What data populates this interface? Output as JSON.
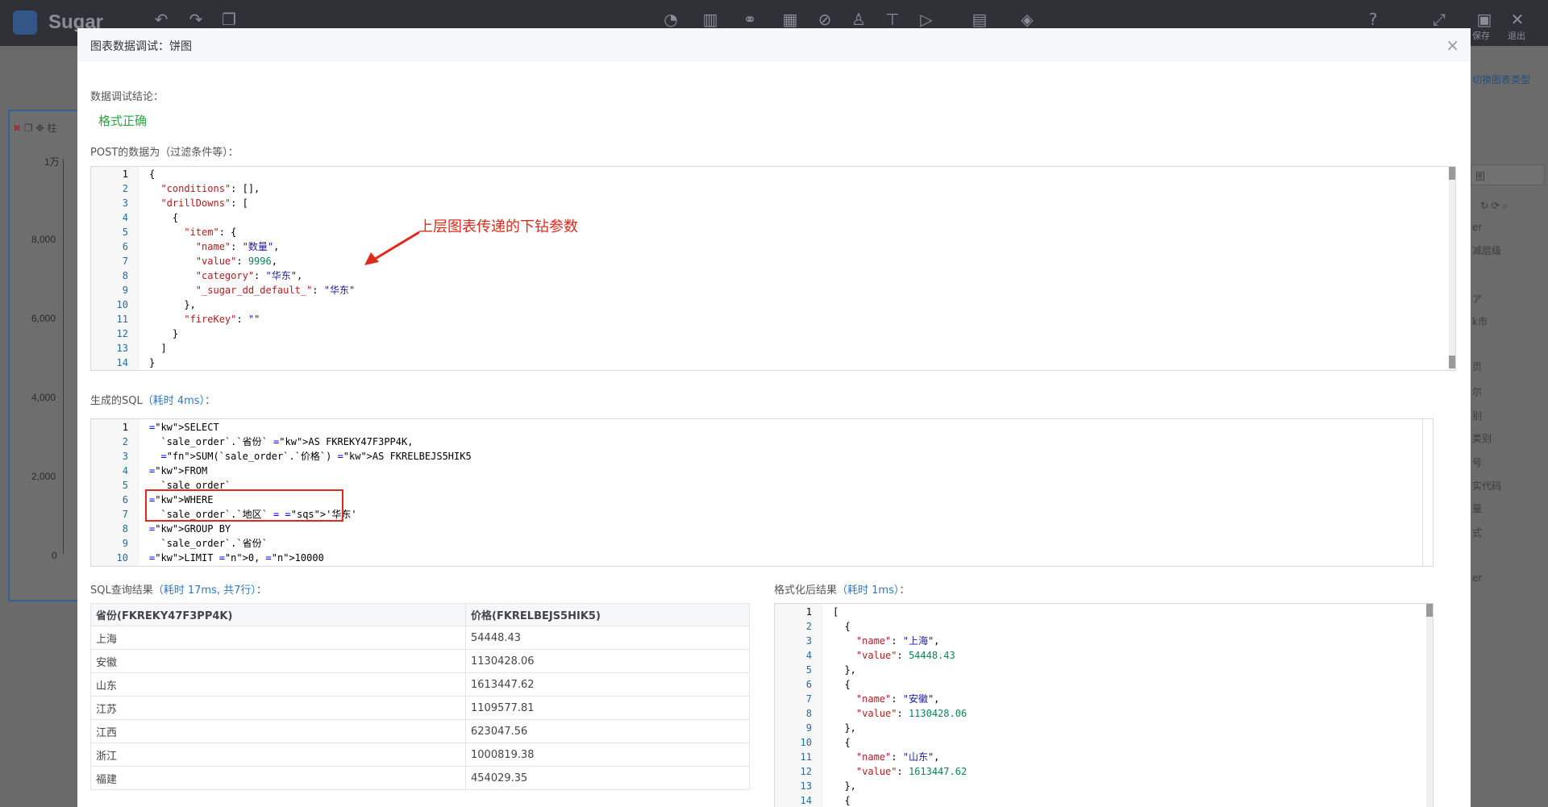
{
  "app": {
    "brand": "Sugar",
    "toolbar_labels": {
      "save": "保存",
      "exit": "退出"
    },
    "switch_chart_type": "切换图表类型"
  },
  "background_chart": {
    "panel_title_fragment": "柱",
    "y_ticks": [
      "1万",
      "8,000",
      "6,000",
      "4,000",
      "2,000",
      "0"
    ]
  },
  "right_sidebar_fragments": [
    "图",
    "er",
    "减层级",
    "ア",
    "k市",
    "页",
    "尔",
    "别",
    "类别",
    "号",
    "实代码",
    "量",
    "式",
    "er"
  ],
  "modal": {
    "title": "图表数据调试：饼图",
    "close": "×",
    "conclusion_label": "数据调试结论：",
    "conclusion": "格式正确",
    "post_label": "POST的数据为（过滤条件等）：",
    "annotation": "上层图表传递的下钻参数",
    "sql_label": "生成的SQL",
    "sql_meta": "（耗时 4ms）",
    "sql_label_suffix": "：",
    "result_label": "SQL查询结果",
    "result_meta": "（耗时 17ms, 共7行）",
    "result_label_suffix": "：",
    "formatted_label": "格式化后结果",
    "formatted_meta": "（耗时 1ms）",
    "formatted_label_suffix": "："
  },
  "post_code": [
    "{",
    "  \"conditions\": [],",
    "  \"drillDowns\": [",
    "    {",
    "      \"item\": {",
    "        \"name\": \"数量\",",
    "        \"value\": 9996,",
    "        \"category\": \"华东\",",
    "        \"_sugar_dd_default_\": \"华东\"",
    "      },",
    "      \"fireKey\": \"\"",
    "    }",
    "  ]",
    "}"
  ],
  "sql_code": [
    "SELECT",
    "  `sale_order`.`省份` AS FKREKY47F3PP4K,",
    "  SUM(`sale_order`.`价格`) AS FKRELBEJS5HIK5",
    "FROM",
    "  `sale_order`",
    "WHERE",
    "  `sale_order`.`地区` = '华东'",
    "GROUP BY",
    "  `sale_order`.`省份`",
    "LIMIT 0, 10000"
  ],
  "result_table": {
    "columns": [
      "省份(FKREKY47F3PP4K)",
      "价格(FKRELBEJS5HIK5)"
    ],
    "rows": [
      [
        "上海",
        "54448.43"
      ],
      [
        "安徽",
        "1130428.06"
      ],
      [
        "山东",
        "1613447.62"
      ],
      [
        "江苏",
        "1109577.81"
      ],
      [
        "江西",
        "623047.56"
      ],
      [
        "浙江",
        "1000819.38"
      ],
      [
        "福建",
        "454029.35"
      ]
    ]
  },
  "formatted_code": [
    "[",
    "  {",
    "    \"name\": \"上海\",",
    "    \"value\": 54448.43",
    "  },",
    "  {",
    "    \"name\": \"安徽\",",
    "    \"value\": 1130428.06",
    "  },",
    "  {",
    "    \"name\": \"山东\",",
    "    \"value\": 1613447.62",
    "  },",
    "  {"
  ],
  "colors": {
    "accent": "#2f78c4",
    "success": "#28a745",
    "annotation": "#e0291c"
  }
}
